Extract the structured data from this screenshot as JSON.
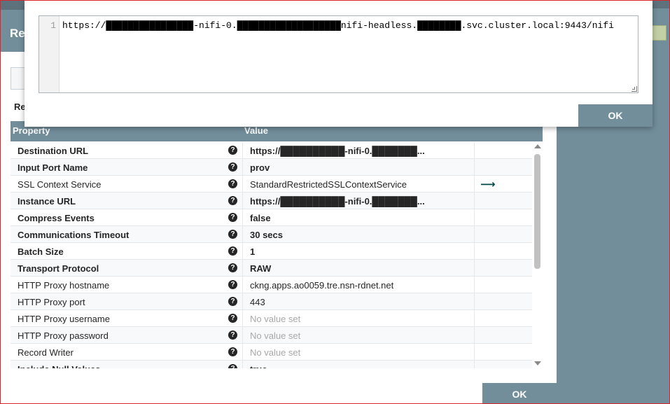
{
  "dialog": {
    "title": "Re",
    "required_label": "Re",
    "ok_label": "OK"
  },
  "table": {
    "headers": {
      "property": "Property",
      "value": "Value"
    },
    "rows": [
      {
        "property": "Destination URL",
        "value": "https://██████████-nifi-0.███████...",
        "required": true,
        "empty": false,
        "action": ""
      },
      {
        "property": "Input Port Name",
        "value": "prov",
        "required": true,
        "empty": false,
        "action": ""
      },
      {
        "property": "SSL Context Service",
        "value": "StandardRestrictedSSLContextService",
        "required": false,
        "empty": false,
        "action": "arrow-right-icon"
      },
      {
        "property": "Instance URL",
        "value": "https://██████████-nifi-0.███████...",
        "required": true,
        "empty": false,
        "action": ""
      },
      {
        "property": "Compress Events",
        "value": "false",
        "required": true,
        "empty": false,
        "action": ""
      },
      {
        "property": "Communications Timeout",
        "value": "30 secs",
        "required": true,
        "empty": false,
        "action": ""
      },
      {
        "property": "Batch Size",
        "value": "1",
        "required": true,
        "empty": false,
        "action": ""
      },
      {
        "property": "Transport Protocol",
        "value": "RAW",
        "required": true,
        "empty": false,
        "action": ""
      },
      {
        "property": "HTTP Proxy hostname",
        "value": "ckng.apps.ao0059.tre.nsn-rdnet.net",
        "required": false,
        "empty": false,
        "action": ""
      },
      {
        "property": "HTTP Proxy port",
        "value": "443",
        "required": false,
        "empty": false,
        "action": ""
      },
      {
        "property": "HTTP Proxy username",
        "value": "No value set",
        "required": false,
        "empty": true,
        "action": ""
      },
      {
        "property": "HTTP Proxy password",
        "value": "No value set",
        "required": false,
        "empty": true,
        "action": ""
      },
      {
        "property": "Record Writer",
        "value": "No value set",
        "required": false,
        "empty": true,
        "action": ""
      },
      {
        "property": "Include Null Values",
        "value": "true",
        "required": true,
        "empty": false,
        "action": ""
      }
    ]
  },
  "editor": {
    "line_number": "1",
    "text": "https://████████████████-nifi-0.███████████████████nifi-headless.████████.svc.cluster.local:9443/nifi",
    "ok_label": "OK"
  },
  "icons": {
    "help": "?",
    "arrow": "⟶"
  },
  "colors": {
    "header": "#728e9b",
    "accent": "#004849",
    "empty_text": "#a8a8a8"
  }
}
